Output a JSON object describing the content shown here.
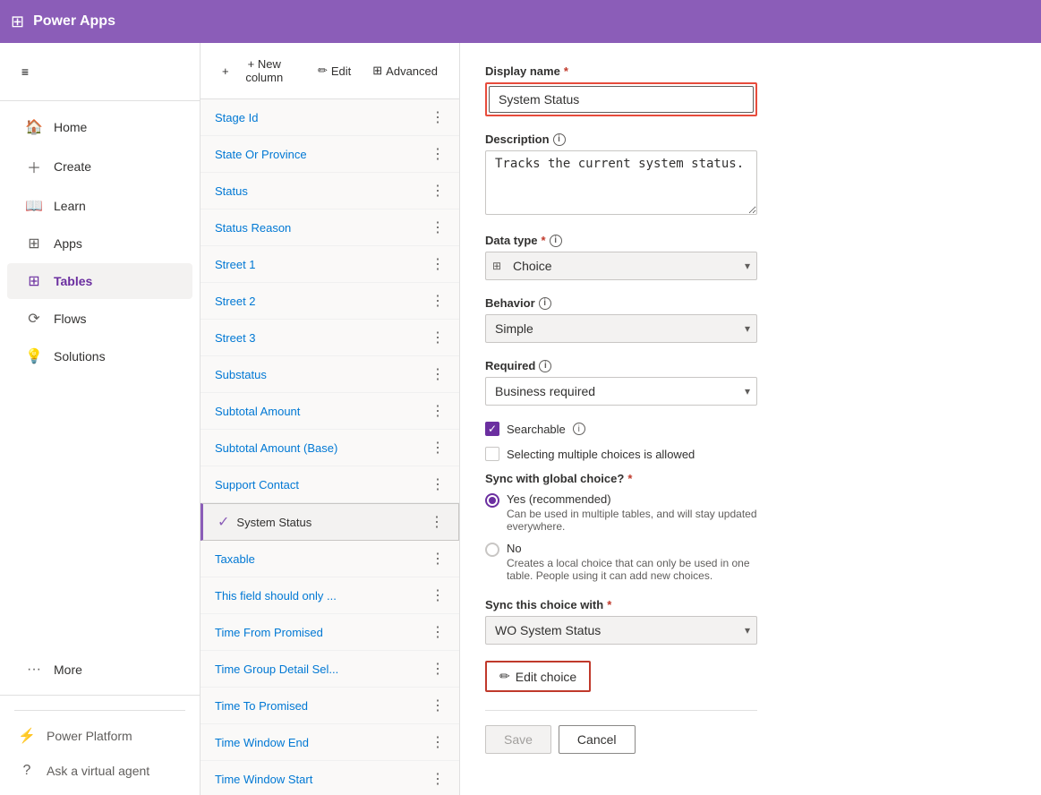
{
  "topbar": {
    "title": "Power Apps",
    "grid_icon": "⊞"
  },
  "sidebar": {
    "hamburger": "≡",
    "items": [
      {
        "id": "home",
        "label": "Home",
        "icon": "🏠"
      },
      {
        "id": "create",
        "label": "Create",
        "icon": "+"
      },
      {
        "id": "learn",
        "label": "Learn",
        "icon": "📖"
      },
      {
        "id": "apps",
        "label": "Apps",
        "icon": "⊞"
      },
      {
        "id": "tables",
        "label": "Tables",
        "icon": "⊞",
        "active": true
      },
      {
        "id": "flows",
        "label": "Flows",
        "icon": "🔄"
      },
      {
        "id": "solutions",
        "label": "Solutions",
        "icon": "💡"
      },
      {
        "id": "more",
        "label": "More",
        "icon": "···"
      }
    ],
    "power_platform": "Power Platform",
    "ask_agent": "Ask a virtual agent"
  },
  "list_panel": {
    "toolbar": {
      "new_column": "+ New column",
      "edit": "✏ Edit",
      "advanced": "⊞ Advanced"
    },
    "items": [
      {
        "id": "stage-id",
        "label": "Stage Id",
        "link": true
      },
      {
        "id": "state-or-province",
        "label": "State Or Province",
        "link": true
      },
      {
        "id": "status",
        "label": "Status",
        "link": true
      },
      {
        "id": "status-reason",
        "label": "Status Reason",
        "link": true
      },
      {
        "id": "street-1",
        "label": "Street 1",
        "link": true
      },
      {
        "id": "street-2",
        "label": "Street 2",
        "link": true
      },
      {
        "id": "street-3",
        "label": "Street 3",
        "link": true
      },
      {
        "id": "substatus",
        "label": "Substatus",
        "link": true
      },
      {
        "id": "subtotal-amount",
        "label": "Subtotal Amount",
        "link": true
      },
      {
        "id": "subtotal-amount-base",
        "label": "Subtotal Amount (Base)",
        "link": true
      },
      {
        "id": "support-contact",
        "label": "Support Contact",
        "link": true
      },
      {
        "id": "system-status",
        "label": "System Status",
        "selected": true
      },
      {
        "id": "taxable",
        "label": "Taxable",
        "link": true
      },
      {
        "id": "this-field",
        "label": "This field should only ...",
        "link": true
      },
      {
        "id": "time-from-promised",
        "label": "Time From Promised",
        "link": true
      },
      {
        "id": "time-group-detail",
        "label": "Time Group Detail Sel...",
        "link": true
      },
      {
        "id": "time-to-promised",
        "label": "Time To Promised",
        "link": true
      },
      {
        "id": "time-window-end",
        "label": "Time Window End",
        "link": true
      },
      {
        "id": "time-window-start",
        "label": "Time Window Start",
        "link": true
      }
    ]
  },
  "form": {
    "display_name_label": "Display name",
    "display_name_value": "System Status",
    "description_label": "Description",
    "description_value": "Tracks the current system status.",
    "data_type_label": "Data type",
    "data_type_value": "Choice",
    "data_type_icon": "⊞",
    "behavior_label": "Behavior",
    "behavior_value": "Simple",
    "required_label": "Required",
    "required_value": "Business required",
    "searchable_label": "Searchable",
    "searchable_checked": true,
    "multiple_choices_label": "Selecting multiple choices is allowed",
    "multiple_choices_checked": false,
    "sync_global_label": "Sync with global choice?",
    "sync_required": "*",
    "yes_label": "Yes (recommended)",
    "yes_desc": "Can be used in multiple tables, and will stay updated everywhere.",
    "no_label": "No",
    "no_desc": "Creates a local choice that can only be used in one table. People using it can add new choices.",
    "sync_this_label": "Sync this choice with",
    "sync_required2": "*",
    "sync_value": "WO System Status",
    "edit_choice_label": "Edit choice",
    "save_label": "Save",
    "cancel_label": "Cancel"
  }
}
